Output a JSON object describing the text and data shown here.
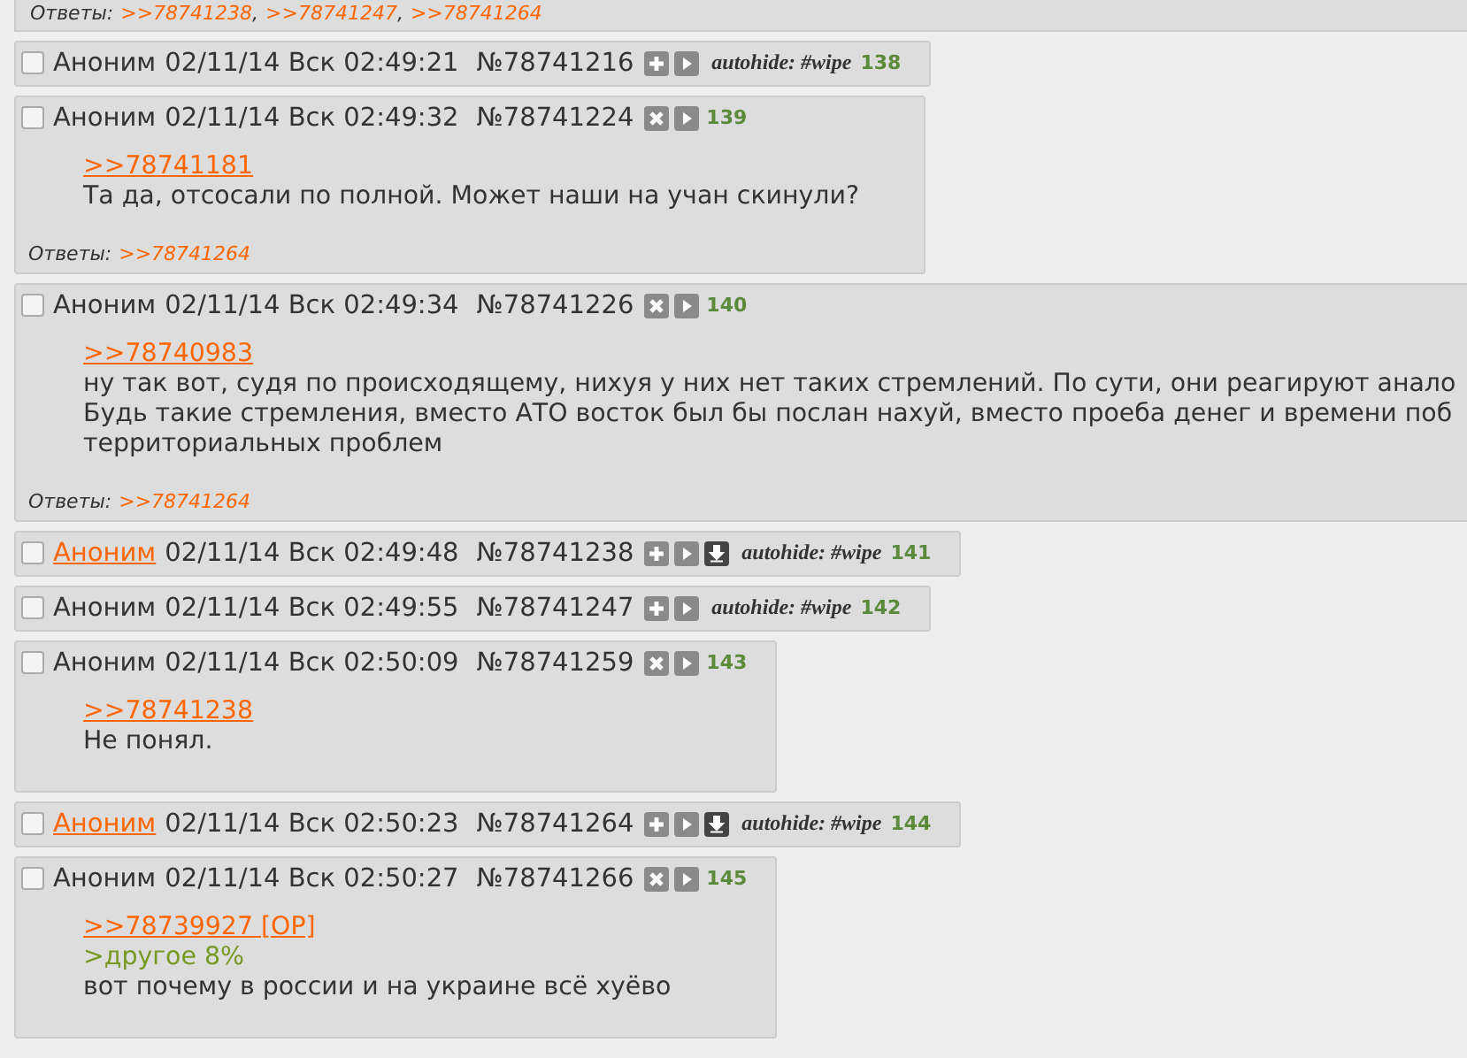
{
  "top_replies": {
    "label": "Ответы:",
    "separator": ",",
    "links": [
      ">>78741238",
      ">>78741247",
      ">>78741264"
    ]
  },
  "posts": [
    {
      "hidden": true,
      "checked": false,
      "name": "Аноним",
      "name_is_link": false,
      "date": "02/11/14 Вск 02:49:21",
      "number": "№78741216",
      "download": false,
      "autohide": "autohide: #wipe",
      "index": "138"
    },
    {
      "hidden": false,
      "checked": false,
      "name": "Аноним",
      "name_is_link": false,
      "date": "02/11/14 Вск 02:49:32",
      "number": "№78741224",
      "download": false,
      "index": "139",
      "lines": [
        {
          "kind": "link",
          "text": ">>78741181"
        },
        {
          "kind": "text",
          "text": "Та да, отсосали по полной. Может наши на учан скинули?"
        }
      ],
      "replies": {
        "label": "Ответы:",
        "links": [
          ">>78741264"
        ]
      }
    },
    {
      "hidden": false,
      "checked": false,
      "name": "Аноним",
      "name_is_link": false,
      "date": "02/11/14 Вск 02:49:34",
      "number": "№78741226",
      "download": false,
      "index": "140",
      "lines": [
        {
          "kind": "link",
          "text": ">>78740983"
        },
        {
          "kind": "text",
          "text": "ну так вот, судя по происходящему, нихуя у них нет таких стремлений. По сути, они реагируют анало"
        },
        {
          "kind": "text",
          "text": "Будь такие стремления, вместо АТО восток был бы послан нахуй, вместо проеба денег и времени поб"
        },
        {
          "kind": "text",
          "text": "территориальных проблем"
        }
      ],
      "replies": {
        "label": "Ответы:",
        "links": [
          ">>78741264"
        ]
      }
    },
    {
      "hidden": true,
      "checked": false,
      "name": "Аноним",
      "name_is_link": true,
      "date": "02/11/14 Вск 02:49:48",
      "number": "№78741238",
      "download": true,
      "autohide": "autohide: #wipe",
      "index": "141"
    },
    {
      "hidden": true,
      "checked": false,
      "name": "Аноним",
      "name_is_link": false,
      "date": "02/11/14 Вск 02:49:55",
      "number": "№78741247",
      "download": false,
      "autohide": "autohide: #wipe",
      "index": "142"
    },
    {
      "hidden": false,
      "checked": false,
      "name": "Аноним",
      "name_is_link": false,
      "date": "02/11/14 Вск 02:50:09",
      "number": "№78741259",
      "download": false,
      "index": "143",
      "lines": [
        {
          "kind": "link",
          "text": ">>78741238"
        },
        {
          "kind": "text",
          "text": "Не понял."
        }
      ]
    },
    {
      "hidden": true,
      "checked": false,
      "name": "Аноним",
      "name_is_link": true,
      "date": "02/11/14 Вск 02:50:23",
      "number": "№78741264",
      "download": true,
      "autohide": "autohide: #wipe",
      "index": "144"
    },
    {
      "hidden": false,
      "checked": false,
      "name": "Аноним",
      "name_is_link": false,
      "date": "02/11/14 Вск 02:50:27",
      "number": "№78741266",
      "download": false,
      "index": "145",
      "lines": [
        {
          "kind": "link",
          "text": ">>78739927 [OP]"
        },
        {
          "kind": "quote",
          "text": ">другое 8%"
        },
        {
          "kind": "text",
          "text": "вот почему в россии и на украине всё хуёво"
        }
      ]
    }
  ]
}
